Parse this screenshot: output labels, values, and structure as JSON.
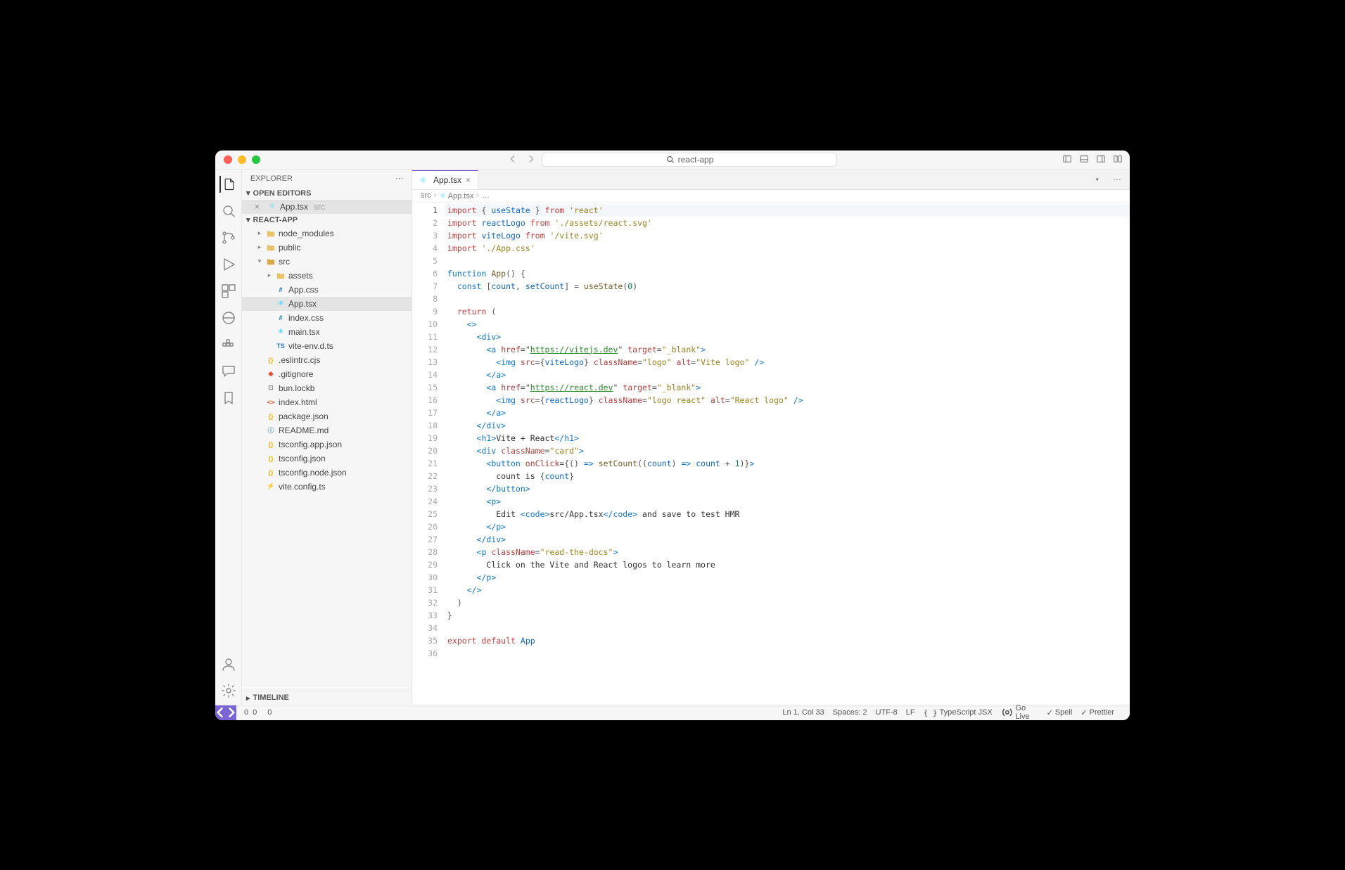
{
  "titlebar": {
    "search": "react-app"
  },
  "sidebar": {
    "title": "EXPLORER",
    "openEditors": {
      "label": "OPEN EDITORS",
      "items": [
        {
          "name": "App.tsx",
          "dir": "src"
        }
      ]
    },
    "project": {
      "label": "REACT-APP",
      "tree": [
        {
          "name": "node_modules",
          "type": "folder",
          "depth": 1,
          "expanded": false
        },
        {
          "name": "public",
          "type": "folder",
          "depth": 1,
          "expanded": false
        },
        {
          "name": "src",
          "type": "folder",
          "depth": 1,
          "expanded": true
        },
        {
          "name": "assets",
          "type": "folder",
          "depth": 2,
          "expanded": false
        },
        {
          "name": "App.css",
          "type": "css",
          "depth": 2
        },
        {
          "name": "App.tsx",
          "type": "react",
          "depth": 2,
          "active": true
        },
        {
          "name": "index.css",
          "type": "css",
          "depth": 2
        },
        {
          "name": "main.tsx",
          "type": "react",
          "depth": 2
        },
        {
          "name": "vite-env.d.ts",
          "type": "ts",
          "depth": 2
        },
        {
          "name": ".eslintrc.cjs",
          "type": "json",
          "depth": 1
        },
        {
          "name": ".gitignore",
          "type": "git",
          "depth": 1
        },
        {
          "name": "bun.lockb",
          "type": "lock",
          "depth": 1
        },
        {
          "name": "index.html",
          "type": "html",
          "depth": 1
        },
        {
          "name": "package.json",
          "type": "json",
          "depth": 1
        },
        {
          "name": "README.md",
          "type": "md",
          "depth": 1
        },
        {
          "name": "tsconfig.app.json",
          "type": "json",
          "depth": 1
        },
        {
          "name": "tsconfig.json",
          "type": "json",
          "depth": 1
        },
        {
          "name": "tsconfig.node.json",
          "type": "json",
          "depth": 1
        },
        {
          "name": "vite.config.ts",
          "type": "vite",
          "depth": 1
        }
      ]
    },
    "timeline": "TIMELINE"
  },
  "editor": {
    "tab": {
      "name": "App.tsx"
    },
    "breadcrumbs": [
      "src",
      "App.tsx",
      "…"
    ],
    "code": [
      [
        [
          "kw",
          "import"
        ],
        [
          "punc",
          " { "
        ],
        [
          "var",
          "useState"
        ],
        [
          "punc",
          " } "
        ],
        [
          "kw",
          "from"
        ],
        [
          "punc",
          " "
        ],
        [
          "str",
          "'react'"
        ]
      ],
      [
        [
          "kw",
          "import"
        ],
        [
          "punc",
          " "
        ],
        [
          "var",
          "reactLogo"
        ],
        [
          "punc",
          " "
        ],
        [
          "kw",
          "from"
        ],
        [
          "punc",
          " "
        ],
        [
          "str",
          "'./assets/react.svg'"
        ]
      ],
      [
        [
          "kw",
          "import"
        ],
        [
          "punc",
          " "
        ],
        [
          "var",
          "viteLogo"
        ],
        [
          "punc",
          " "
        ],
        [
          "kw",
          "from"
        ],
        [
          "punc",
          " "
        ],
        [
          "str",
          "'/vite.svg'"
        ]
      ],
      [
        [
          "kw",
          "import"
        ],
        [
          "punc",
          " "
        ],
        [
          "str",
          "'./App.css'"
        ]
      ],
      [],
      [
        [
          "kw2",
          "function"
        ],
        [
          "punc",
          " "
        ],
        [
          "fn",
          "App"
        ],
        [
          "punc",
          "() {"
        ]
      ],
      [
        [
          "punc",
          "  "
        ],
        [
          "kw2",
          "const"
        ],
        [
          "punc",
          " ["
        ],
        [
          "var",
          "count"
        ],
        [
          "punc",
          ", "
        ],
        [
          "var",
          "setCount"
        ],
        [
          "punc",
          "] = "
        ],
        [
          "fn",
          "useState"
        ],
        [
          "punc",
          "("
        ],
        [
          "num",
          "0"
        ],
        [
          "punc",
          ")"
        ]
      ],
      [],
      [
        [
          "punc",
          "  "
        ],
        [
          "kw",
          "return"
        ],
        [
          "punc",
          " ("
        ]
      ],
      [
        [
          "punc",
          "    "
        ],
        [
          "tag",
          "<>"
        ]
      ],
      [
        [
          "punc",
          "      "
        ],
        [
          "tag",
          "<div>"
        ]
      ],
      [
        [
          "punc",
          "        "
        ],
        [
          "tag",
          "<a"
        ],
        [
          "punc",
          " "
        ],
        [
          "attr",
          "href"
        ],
        [
          "punc",
          "="
        ],
        [
          "punc",
          "\""
        ],
        [
          "link",
          "https://vitejs.dev"
        ],
        [
          "punc",
          "\" "
        ],
        [
          "attr",
          "target"
        ],
        [
          "punc",
          "="
        ],
        [
          "str",
          "\"_blank\""
        ],
        [
          "tag",
          ">"
        ]
      ],
      [
        [
          "punc",
          "          "
        ],
        [
          "tag",
          "<img"
        ],
        [
          "punc",
          " "
        ],
        [
          "attr",
          "src"
        ],
        [
          "punc",
          "={"
        ],
        [
          "var",
          "viteLogo"
        ],
        [
          "punc",
          "} "
        ],
        [
          "attr",
          "className"
        ],
        [
          "punc",
          "="
        ],
        [
          "str",
          "\"logo\""
        ],
        [
          "punc",
          " "
        ],
        [
          "attr",
          "alt"
        ],
        [
          "punc",
          "="
        ],
        [
          "str",
          "\"Vite logo\""
        ],
        [
          "punc",
          " "
        ],
        [
          "tag",
          "/>"
        ]
      ],
      [
        [
          "punc",
          "        "
        ],
        [
          "tag",
          "</a>"
        ]
      ],
      [
        [
          "punc",
          "        "
        ],
        [
          "tag",
          "<a"
        ],
        [
          "punc",
          " "
        ],
        [
          "attr",
          "href"
        ],
        [
          "punc",
          "="
        ],
        [
          "punc",
          "\""
        ],
        [
          "link",
          "https://react.dev"
        ],
        [
          "punc",
          "\" "
        ],
        [
          "attr",
          "target"
        ],
        [
          "punc",
          "="
        ],
        [
          "str",
          "\"_blank\""
        ],
        [
          "tag",
          ">"
        ]
      ],
      [
        [
          "punc",
          "          "
        ],
        [
          "tag",
          "<img"
        ],
        [
          "punc",
          " "
        ],
        [
          "attr",
          "src"
        ],
        [
          "punc",
          "={"
        ],
        [
          "var",
          "reactLogo"
        ],
        [
          "punc",
          "} "
        ],
        [
          "attr",
          "className"
        ],
        [
          "punc",
          "="
        ],
        [
          "str",
          "\"logo react\""
        ],
        [
          "punc",
          " "
        ],
        [
          "attr",
          "alt"
        ],
        [
          "punc",
          "="
        ],
        [
          "str",
          "\"React logo\""
        ],
        [
          "punc",
          " "
        ],
        [
          "tag",
          "/>"
        ]
      ],
      [
        [
          "punc",
          "        "
        ],
        [
          "tag",
          "</a>"
        ]
      ],
      [
        [
          "punc",
          "      "
        ],
        [
          "tag",
          "</div>"
        ]
      ],
      [
        [
          "punc",
          "      "
        ],
        [
          "tag",
          "<h1>"
        ],
        [
          "text",
          "Vite + React"
        ],
        [
          "tag",
          "</h1>"
        ]
      ],
      [
        [
          "punc",
          "      "
        ],
        [
          "tag",
          "<div"
        ],
        [
          "punc",
          " "
        ],
        [
          "attr",
          "className"
        ],
        [
          "punc",
          "="
        ],
        [
          "str",
          "\"card\""
        ],
        [
          "tag",
          ">"
        ]
      ],
      [
        [
          "punc",
          "        "
        ],
        [
          "tag",
          "<button"
        ],
        [
          "punc",
          " "
        ],
        [
          "attr",
          "onClick"
        ],
        [
          "punc",
          "={"
        ],
        [
          "punc",
          "() "
        ],
        [
          "kw2",
          "=>"
        ],
        [
          "punc",
          " "
        ],
        [
          "fn",
          "setCount"
        ],
        [
          "punc",
          "(("
        ],
        [
          "var",
          "count"
        ],
        [
          "punc",
          ") "
        ],
        [
          "kw2",
          "=>"
        ],
        [
          "punc",
          " "
        ],
        [
          "var",
          "count"
        ],
        [
          "punc",
          " + "
        ],
        [
          "num",
          "1"
        ],
        [
          "punc",
          ")}"
        ],
        [
          "tag",
          ">"
        ]
      ],
      [
        [
          "punc",
          "          "
        ],
        [
          "text",
          "count is "
        ],
        [
          "punc",
          "{"
        ],
        [
          "var",
          "count"
        ],
        [
          "punc",
          "}"
        ]
      ],
      [
        [
          "punc",
          "        "
        ],
        [
          "tag",
          "</button>"
        ]
      ],
      [
        [
          "punc",
          "        "
        ],
        [
          "tag",
          "<p>"
        ]
      ],
      [
        [
          "punc",
          "          "
        ],
        [
          "text",
          "Edit "
        ],
        [
          "tag",
          "<code>"
        ],
        [
          "text",
          "src/App.tsx"
        ],
        [
          "tag",
          "</code>"
        ],
        [
          "text",
          " and save to test HMR"
        ]
      ],
      [
        [
          "punc",
          "        "
        ],
        [
          "tag",
          "</p>"
        ]
      ],
      [
        [
          "punc",
          "      "
        ],
        [
          "tag",
          "</div>"
        ]
      ],
      [
        [
          "punc",
          "      "
        ],
        [
          "tag",
          "<p"
        ],
        [
          "punc",
          " "
        ],
        [
          "attr",
          "className"
        ],
        [
          "punc",
          "="
        ],
        [
          "str",
          "\"read-the-docs\""
        ],
        [
          "tag",
          ">"
        ]
      ],
      [
        [
          "punc",
          "        "
        ],
        [
          "text",
          "Click on the Vite and React logos to learn more"
        ]
      ],
      [
        [
          "punc",
          "      "
        ],
        [
          "tag",
          "</p>"
        ]
      ],
      [
        [
          "punc",
          "    "
        ],
        [
          "tag",
          "</>"
        ]
      ],
      [
        [
          "punc",
          "  )"
        ]
      ],
      [
        [
          "punc",
          "}"
        ]
      ],
      [],
      [
        [
          "kw",
          "export"
        ],
        [
          "punc",
          " "
        ],
        [
          "kw",
          "default"
        ],
        [
          "punc",
          " "
        ],
        [
          "var",
          "App"
        ]
      ],
      []
    ]
  },
  "statusbar": {
    "errors": "0",
    "warnings": "0",
    "ports": "0",
    "position": "Ln 1, Col 33",
    "spaces": "Spaces: 2",
    "encoding": "UTF-8",
    "eol": "LF",
    "lang": "TypeScript JSX",
    "golive": "Go Live",
    "spell": "Spell",
    "prettier": "Prettier"
  }
}
